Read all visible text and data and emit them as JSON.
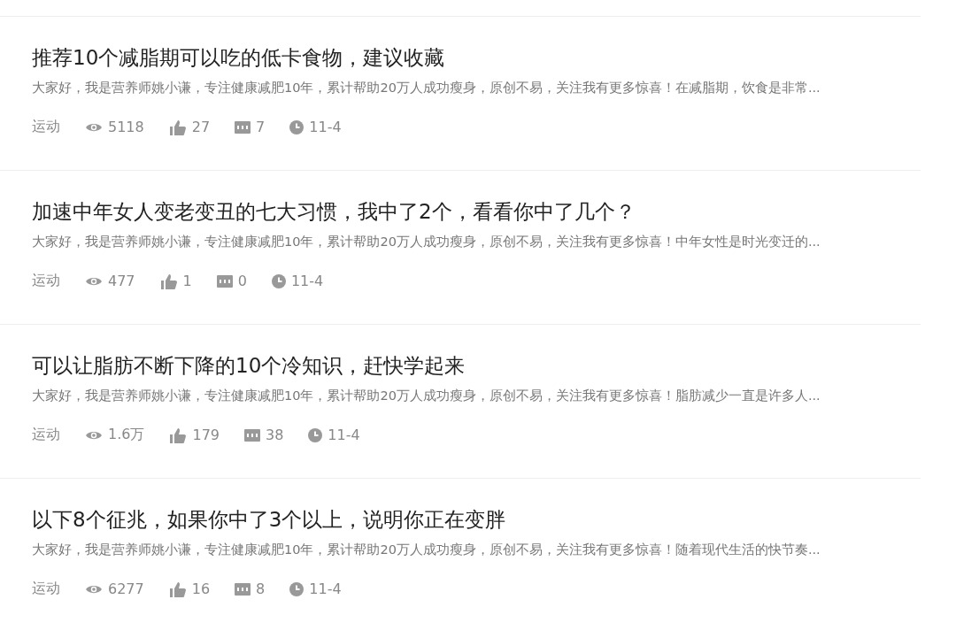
{
  "articles": [
    {
      "title": "推荐10个减脂期可以吃的低卡食物，建议收藏",
      "summary": "大家好，我是营养师姚小谦，专注健康减肥10年，累计帮助20万人成功瘦身，原创不易，关注我有更多惊喜！在减脂期，饮食是非常...",
      "category": "运动",
      "views": "5118",
      "likes": "27",
      "comments": "7",
      "date": "11-4"
    },
    {
      "title": "加速中年女人变老变丑的七大习惯，我中了2个，看看你中了几个？",
      "summary": "大家好，我是营养师姚小谦，专注健康减肥10年，累计帮助20万人成功瘦身，原创不易，关注我有更多惊喜！中年女性是时光变迁的...",
      "category": "运动",
      "views": "477",
      "likes": "1",
      "comments": "0",
      "date": "11-4"
    },
    {
      "title": "可以让脂肪不断下降的10个冷知识，赶快学起来",
      "summary": "大家好，我是营养师姚小谦，专注健康减肥10年，累计帮助20万人成功瘦身，原创不易，关注我有更多惊喜！脂肪减少一直是许多人...",
      "category": "运动",
      "views": "1.6万",
      "likes": "179",
      "comments": "38",
      "date": "11-4"
    },
    {
      "title": "以下8个征兆，如果你中了3个以上，说明你正在变胖",
      "summary": "大家好，我是营养师姚小谦，专注健康减肥10年，累计帮助20万人成功瘦身，原创不易，关注我有更多惊喜！随着现代生活的快节奏...",
      "category": "运动",
      "views": "6277",
      "likes": "16",
      "comments": "8",
      "date": "11-4"
    }
  ]
}
